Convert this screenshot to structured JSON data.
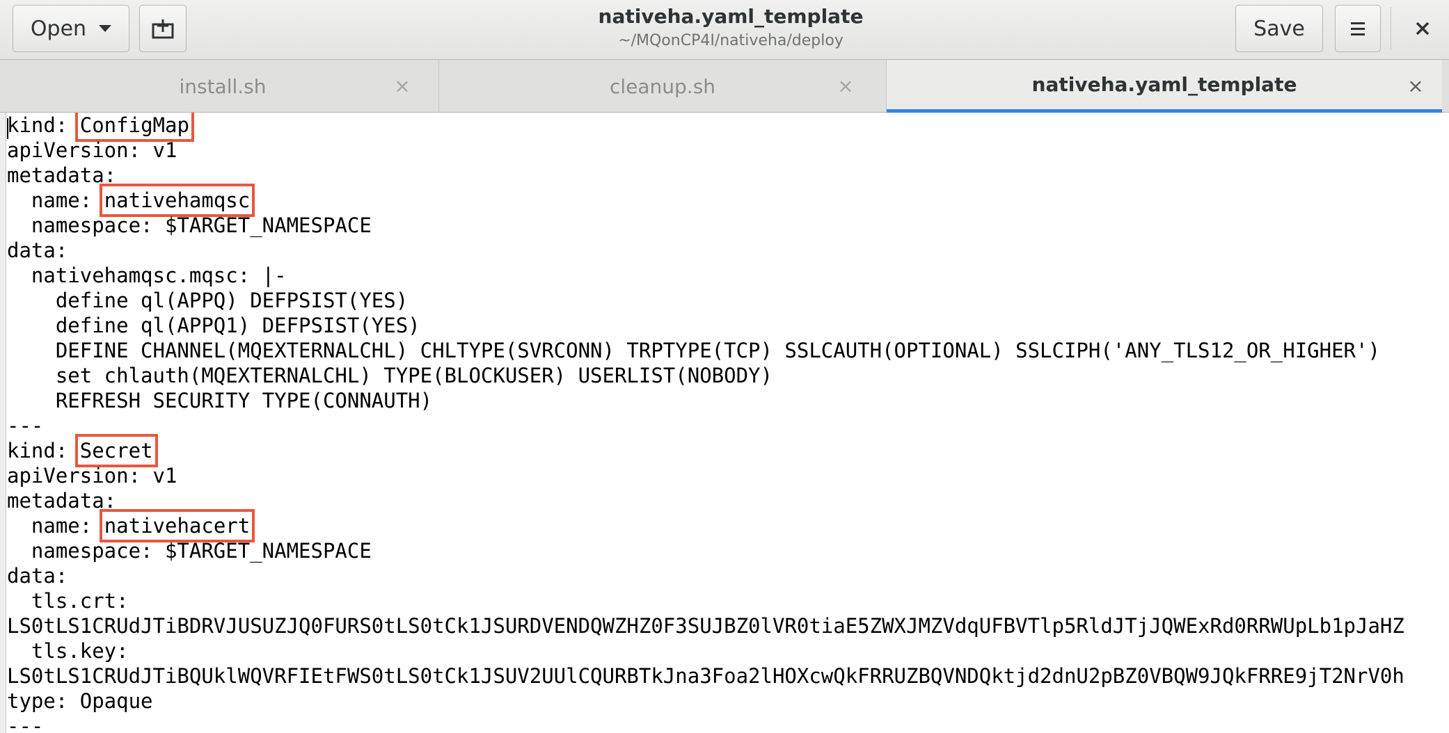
{
  "header": {
    "open_label": "Open",
    "save_label": "Save",
    "title": "nativeha.yaml_template",
    "subtitle": "~/MQonCP4I/nativeha/deploy",
    "close_symbol": "×"
  },
  "tabs": [
    {
      "label": "install.sh",
      "active": false
    },
    {
      "label": "cleanup.sh",
      "active": false
    },
    {
      "label": "nativeha.yaml_template",
      "active": true
    }
  ],
  "tab_close_symbol": "×",
  "editor": {
    "lines": [
      {
        "pre": "kind: ",
        "hl": "ConfigMap",
        "post": ""
      },
      {
        "pre": "apiVersion: v1"
      },
      {
        "pre": "metadata:"
      },
      {
        "pre": "  name: ",
        "hl": "nativehamqsc",
        "post": ""
      },
      {
        "pre": "  namespace: $TARGET_NAMESPACE"
      },
      {
        "pre": "data:"
      },
      {
        "pre": "  nativehamqsc.mqsc: |-"
      },
      {
        "pre": "    define ql(APPQ) DEFPSIST(YES)"
      },
      {
        "pre": "    define ql(APPQ1) DEFPSIST(YES)"
      },
      {
        "pre": "    DEFINE CHANNEL(MQEXTERNALCHL) CHLTYPE(SVRCONN) TRPTYPE(TCP) SSLCAUTH(OPTIONAL) SSLCIPH('ANY_TLS12_OR_HIGHER')"
      },
      {
        "pre": "    set chlauth(MQEXTERNALCHL) TYPE(BLOCKUSER) USERLIST(NOBODY)"
      },
      {
        "pre": "    REFRESH SECURITY TYPE(CONNAUTH)"
      },
      {
        "pre": "---"
      },
      {
        "pre": "kind: ",
        "hl": "Secret",
        "post": ""
      },
      {
        "pre": "apiVersion: v1"
      },
      {
        "pre": "metadata:"
      },
      {
        "pre": "  name: ",
        "hl": "nativehacert",
        "post": ""
      },
      {
        "pre": "  namespace: $TARGET_NAMESPACE"
      },
      {
        "pre": "data:"
      },
      {
        "pre": "  tls.crt:"
      },
      {
        "pre": "LS0tLS1CRUdJTiBDRVJUSUZJQ0FURS0tLS0tCk1JSURDVENDQWZHZ0F3SUJBZ0lVR0tiaE5ZWXJMZVdqUFBVTlp5RldJTjJQWExRd0RRWUpLb1pJaHZ"
      },
      {
        "pre": "  tls.key:"
      },
      {
        "pre": "LS0tLS1CRUdJTiBQUklWQVRFIEtFWS0tLS0tCk1JSUV2UUlCQURBTkJna3Foa2lHOXcwQkFRRUZBQVNDQktjd2dnU2pBZ0VBQW9JQkFRRE9jT2NrV0h"
      },
      {
        "pre": "type: Opaque"
      },
      {
        "pre": "---"
      }
    ]
  }
}
